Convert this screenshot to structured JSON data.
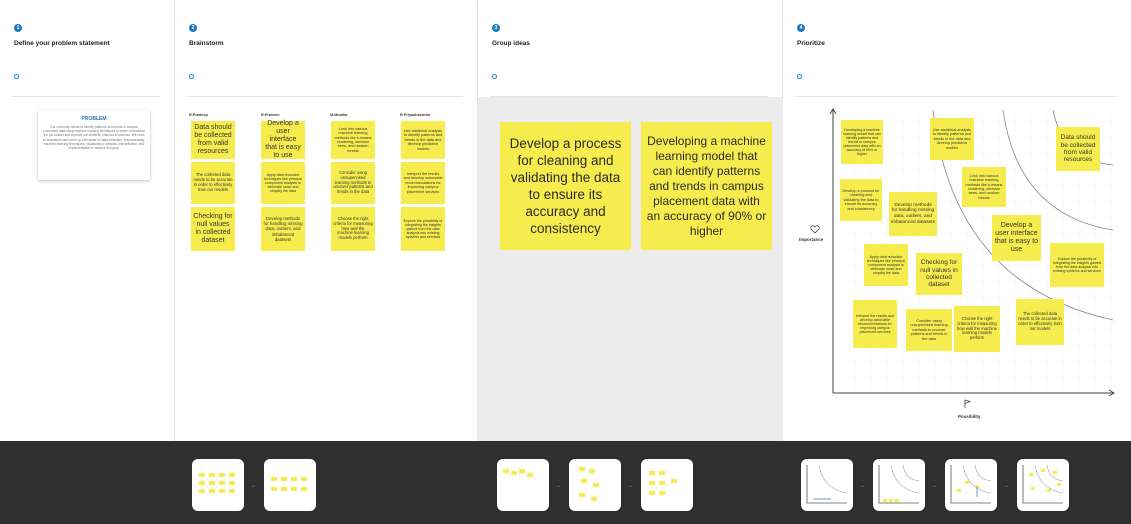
{
  "steps": [
    {
      "num": "1",
      "title": "Define your problem statement"
    },
    {
      "num": "2",
      "title": "Brainstorm"
    },
    {
      "num": "3",
      "title": "Group ideas"
    },
    {
      "num": "4",
      "title": "Prioritize"
    }
  ],
  "info_icon": "info-icon",
  "problem": {
    "title": "PROBLEM",
    "text": "Our university needs to identify patterns and trends in campus placement data using machine learning techniques to better understand the job market and improve our students' chances of success. We need to brainstorm and come up with ideas for data collection, preprocessing, machine learning techniques, visualization, analysis, interpretation, and implementation to achieve this goal."
  },
  "brainstorm": {
    "people": [
      "R.Pradeep",
      "R.Praveen",
      "M.Monika",
      "R.Priyadharshini"
    ],
    "columns": [
      [
        "Data should be collected from valid resources",
        "The collected data needs to be accurate in order to effectively train our models",
        "Checking for null values in collected dataset"
      ],
      [
        "Develop a user interface that is easy to use",
        "Apply data reduction techniques like principal component analysis to eliminate noise and simplify the data",
        "Develop methods for handling missing data, outliers, and imbalanced datasets"
      ],
      [
        "Look into various machine learning methods like k-means clustering, decision trees, and random forests",
        "Consider using unsupervised learning methods to uncover patterns and trends in the data",
        "Choose the right criteria for measuring how well the machine learning models perform"
      ],
      [
        "Use statistical analysis to identify patterns and trends in the data and develop predictive models",
        "Interpret the results and develop actionable recommendations for improving campus placement services",
        "Explore the possibility of integrating the insights gained from the data analysis into existing systems and services"
      ]
    ]
  },
  "group": {
    "stickies": [
      "Develop a process for cleaning and validating the data to ensure its accuracy and consistency",
      "Developing a machine learning model that can identify patterns and trends in campus placement data with an accuracy of 90% or higher"
    ]
  },
  "prioritize": {
    "y_label": "Importance",
    "x_label": "Possibility",
    "y_icon": "heart-icon",
    "x_icon": "flag-icon",
    "stickies": [
      "Developing a machine learning model that can identify patterns and trends in campus placement data with an accuracy of 90% or higher",
      "Use statistical analysis to identify patterns and trends in the data and develop predictive models",
      "Data should be collected from valid resources",
      "Look into various machine learning methods like k-means clustering, decision trees, and random forests",
      "Develop a process for cleaning and validating the data to ensure its accuracy and consistency",
      "Develop methods for handling missing data, outliers, and imbalanced datasets",
      "Develop a user interface that is easy to use",
      "Apply data reduction techniques like principal component analysis to eliminate noise and simplify the data",
      "Checking for null values in collected dataset",
      "Explore the possibility of integrating the insights gained from the data analysis into existing systems and services",
      "Interpret the results and develop actionable recommendations for improving campus placement services",
      "Consider using unsupervised learning methods to uncover patterns and trends in the data",
      "Choose the right criteria for measuring how well the machine learning models perform",
      "The collected data needs to be accurate in order to effectively train our models"
    ]
  },
  "colors": {
    "sticky": "#f7ec4e",
    "accent": "#1b7bbd",
    "footer": "#2f2f2f"
  }
}
